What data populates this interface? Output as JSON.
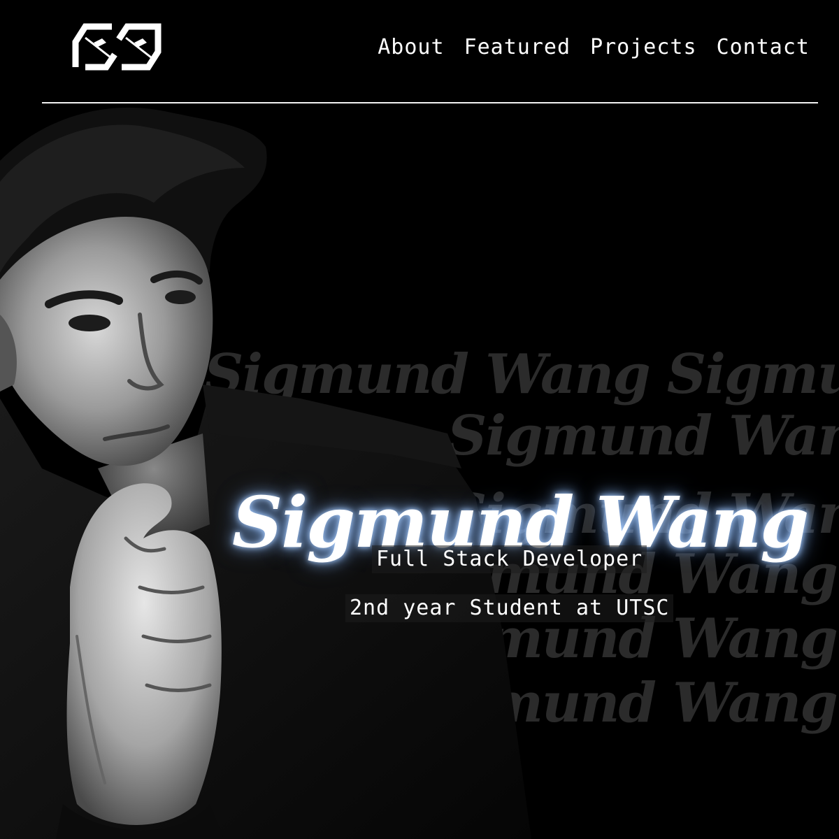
{
  "header": {
    "logo_icon": "ss-monogram-logo",
    "nav": [
      {
        "label": "About"
      },
      {
        "label": "Featured"
      },
      {
        "label": "Projects"
      },
      {
        "label": "Contact"
      }
    ]
  },
  "hero": {
    "name": "Sigmund Wang",
    "role": "Full Stack Developer",
    "school": "2nd year Student at UTSC",
    "watermark_text": "Sigmund Wang Sigmund Wang",
    "portrait": "black-and-white-portrait-photo",
    "colors": {
      "background": "#000000",
      "text": "#ffffff",
      "glow": "#a9cdff",
      "watermark": "#2b2b2b"
    }
  }
}
